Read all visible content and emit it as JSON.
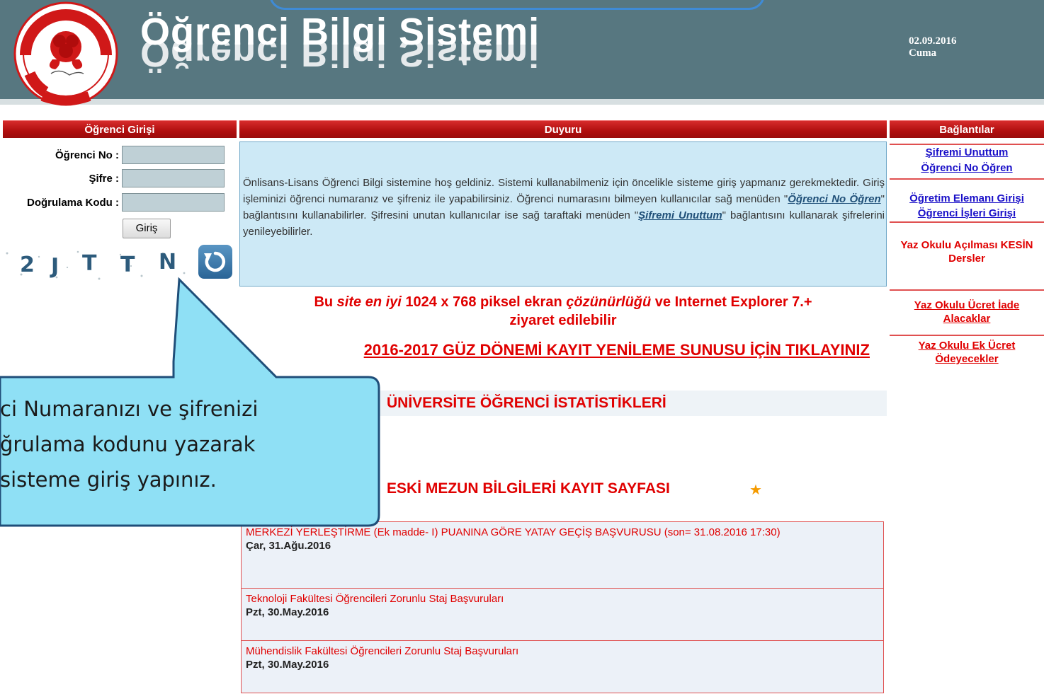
{
  "header": {
    "title": "Öğrenci Bilgi Sistemi",
    "date": "02.09.2016",
    "day": "Cuma",
    "logo": {
      "icon": "rose-seal-logo",
      "ring_text": "SÜLEYMAN DEMİREL ÜNİVERSİTESİ",
      "year": "1992",
      "signature": "S.Demirel"
    }
  },
  "sections": {
    "login": "Öğrenci Girişi",
    "announcement": "Duyuru",
    "links": "Bağlantılar"
  },
  "login": {
    "student_no_label": "Öğrenci No :",
    "password_label": "Şifre :",
    "captcha_label": "Doğrulama Kodu :",
    "student_no_value": "",
    "password_value": "",
    "captcha_value": "",
    "submit_label": "Giriş",
    "captcha_text": "2JTTN",
    "refresh_icon": "refresh-icon"
  },
  "announcement": {
    "p1": "Önlisans-Lisans Öğrenci Bilgi sistemine hoş geldiniz. Sistemi kullanabilmeniz için öncelikle sisteme giriş yapmanız gerekmektedir. Giriş işleminizi öğrenci numaranız ve şifreniz ile yapabilirsiniz. Öğrenci numarasını bilmeyen kullanıcılar sağ menüden \"",
    "link1": "Öğrenci No Öğren",
    "p2": "\" bağlantısını kullanabilirler. Şifresini unutan kullanıcılar ise sağ taraftaki menüden \"",
    "link2": "Şifremi Unuttum",
    "p3": "\" bağlantısını kullanarak şifrelerini yenileyebilirler."
  },
  "notice": {
    "a": "Bu ",
    "b": "site en iyi",
    "c": " 1024 x 768 piksel ekran ",
    "d": "çözünürlüğü",
    "e": " ve Internet Explorer 7.+",
    "line2": "ziyaret edilebilir"
  },
  "main_links": {
    "registration": "2016-2017 GÜZ DÖNEMİ KAYIT YENİLEME SUNUSU İÇİN TIKLAYINIZ",
    "statistics": "ÜNİVERSİTE ÖĞRENCİ İSTATİSTİKLERİ",
    "alumni": "ESKİ MEZUN BİLGİLERİ KAYIT SAYFASI"
  },
  "news": [
    {
      "title": "MERKEZİ YERLEŞTİRME (Ek madde- I) PUANINA GÖRE YATAY GEÇİŞ BAŞVURUSU (son= 31.08.2016 17:30)",
      "date": "Çar, 31.Ağu.2016"
    },
    {
      "title": "Teknoloji Fakültesi Öğrencileri Zorunlu Staj Başvuruları",
      "date": "Pzt, 30.May.2016"
    },
    {
      "title": "Mühendislik Fakültesi Öğrencileri Zorunlu Staj Başvuruları",
      "date": "Pzt, 30.May.2016"
    }
  ],
  "links": {
    "forgot_password": "Şifremi Unuttum",
    "learn_student_no": "Öğrenci No Öğren",
    "staff_login": "Öğretim Elemanı Girişi",
    "student_affairs_login": "Öğrenci İşleri Girişi",
    "summer_courses": "Yaz Okulu Açılması KESİN Dersler",
    "summer_refund": "Yaz Okulu Ücret İade Alacaklar",
    "summer_extra_fee": "Yaz Okulu Ek Ücret Ödeyecekler"
  },
  "callout": {
    "line1": "ci Numaranızı ve şifrenizi",
    "line2": "ğrulama kodunu yazarak",
    "line3": "sisteme giriş yapınız."
  },
  "colors": {
    "header_bg": "#577780",
    "bar_red": "#b00e0e",
    "link_blue": "#1a10c8",
    "link_red": "#e00000",
    "announcement_bg": "#cde9f6",
    "callout_fill": "#8fe0f5",
    "callout_border": "#1f4e79"
  }
}
